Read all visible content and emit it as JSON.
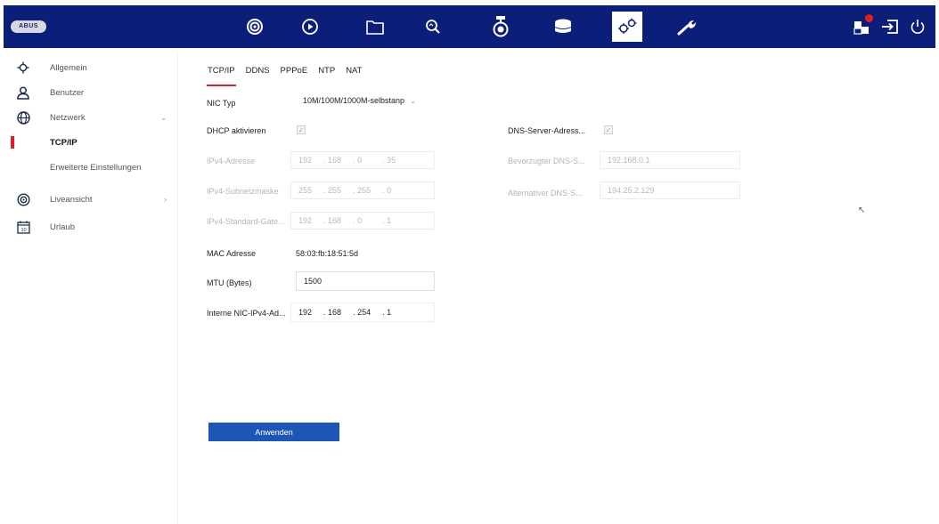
{
  "header": {
    "logo_text": "ABUS",
    "icons": [
      "live-view-icon",
      "playback-icon",
      "file-icon",
      "search-icon",
      "camera-icon",
      "storage-icon",
      "settings-icon",
      "maintenance-icon",
      "alarm-icon",
      "logout-icon",
      "power-icon"
    ],
    "active_icon": "settings-icon",
    "accent_color": "#0b1f7a"
  },
  "sidebar": {
    "items": [
      {
        "label": "Allgemein",
        "icon": "gear-icon"
      },
      {
        "label": "Benutzer",
        "icon": "user-icon"
      },
      {
        "label": "Netzwerk",
        "icon": "globe-icon"
      },
      {
        "label": "TCP/IP"
      },
      {
        "label": "Erweiterte Einstellungen"
      },
      {
        "label": "Liveansicht",
        "icon": "camera-icon"
      },
      {
        "label": "Urlaub",
        "icon": "calendar-icon"
      }
    ],
    "calendar_day": "10",
    "active_color": "#d8232a"
  },
  "tabs": [
    "TCP/IP",
    "DDNS",
    "PPPoE",
    "NTP",
    "NAT"
  ],
  "form": {
    "nic_type_label": "NIC Typ",
    "nic_type_value": "10M/100M/1000M-selbstanp",
    "dhcp_label": "DHCP aktivieren",
    "dns_auto_label": "DNS-Server-Adress...",
    "ipv4_label": "IPv4-Adresse",
    "ipv4_value": [
      "192",
      "168",
      "0",
      "35"
    ],
    "subnet_label": "IPv4-Subnetzmaske",
    "subnet_value": [
      "255",
      "255",
      "255",
      "0"
    ],
    "gateway_label": "IPv4-Standard-Gate...",
    "gateway_value": [
      "192",
      "168",
      "0",
      "1"
    ],
    "dns_pref_label": "Bevorzugter DNS-S...",
    "dns_pref_value": "192.168.0.1",
    "dns_alt_label": "Alternativer DNS-S...",
    "dns_alt_value": "194.25.2.129",
    "mac_label": "MAC Adresse",
    "mac_value": "58:03:fb:18:51:5d",
    "mtu_label": "MTU (Bytes)",
    "mtu_value": "1500",
    "internal_label": "Interne NIC-IPv4-Ad...",
    "internal_value": [
      "192",
      "168",
      "254",
      "1"
    ],
    "dot": "."
  },
  "apply_label": "Anwenden",
  "button_color": "#1e56b8"
}
